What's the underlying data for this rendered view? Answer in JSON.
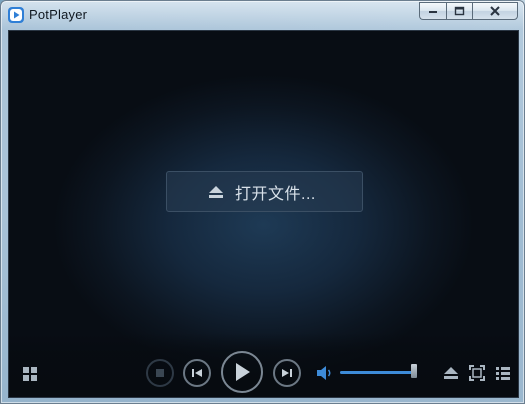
{
  "window": {
    "title": "PotPlayer",
    "app_icon": "potplayer-logo-icon"
  },
  "caption_buttons": {
    "minimize_icon": "minimize-icon",
    "maximize_icon": "maximize-icon",
    "close_icon": "close-icon"
  },
  "center": {
    "open_file_label": "打开文件...",
    "open_file_icon": "eject-icon"
  },
  "controls": {
    "left": [
      "grid-menu-icon"
    ],
    "transport": [
      "stop-icon",
      "previous-icon",
      "play-icon",
      "next-icon"
    ],
    "volume_icon": "speaker-icon",
    "volume_level": 0.97,
    "right": [
      "eject-icon",
      "fullscreen-icon",
      "playlist-icon"
    ]
  },
  "colors": {
    "accent": "#3d8bd8",
    "viewport_bg": "#0c1520",
    "close_glyph": "#3a2a2a"
  }
}
